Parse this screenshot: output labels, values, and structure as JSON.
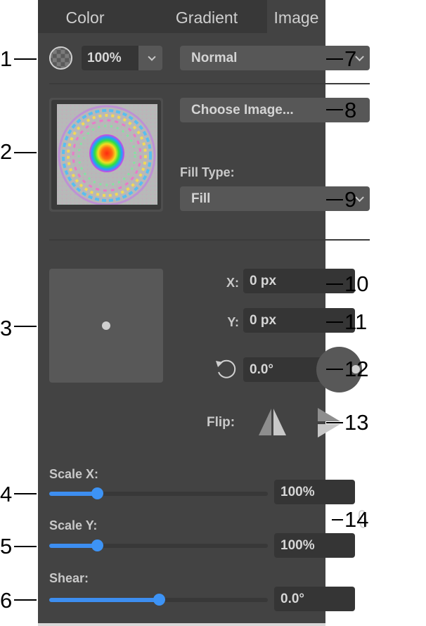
{
  "tabs": [
    {
      "label": "Color",
      "active": false
    },
    {
      "label": "Gradient",
      "active": false
    },
    {
      "label": "Image",
      "active": true
    }
  ],
  "opacity": {
    "icon": "opacity-checker-icon",
    "value": "100%"
  },
  "blend_mode": {
    "selected": "Normal"
  },
  "image": {
    "choose_button": "Choose Image...",
    "thumbnail": "image-thumbnail"
  },
  "fill_type": {
    "label": "Fill Type:",
    "selected": "Fill"
  },
  "offset": {
    "x_label": "X:",
    "x_value": "0 px",
    "y_label": "Y:",
    "y_value": "0 px"
  },
  "rotation": {
    "icon": "rotate-ccw-icon",
    "value": "0.0°",
    "dial_angle_deg": 0
  },
  "flip": {
    "label": "Flip:",
    "horizontal_icon": "flip-horizontal-icon",
    "vertical_icon": "flip-vertical-icon"
  },
  "scale_x": {
    "label": "Scale X:",
    "value": "100%",
    "slider_fraction": 0.22
  },
  "scale_y": {
    "label": "Scale Y:",
    "value": "100%",
    "slider_fraction": 0.22
  },
  "shear": {
    "label": "Shear:",
    "value": "0.0°",
    "slider_fraction": 0.5
  },
  "link_icon": "link-icon",
  "colors": {
    "accent": "#3d8ef0",
    "panel": "#434343",
    "field": "#353535",
    "dropdown": "#575757"
  },
  "callouts": {
    "c1": "1",
    "c2": "2",
    "c3": "3",
    "c4": "4",
    "c5": "5",
    "c6": "6",
    "c7": "7",
    "c8": "8",
    "c9": "9",
    "c10": "10",
    "c11": "11",
    "c12": "12",
    "c13": "13",
    "c14": "14"
  }
}
